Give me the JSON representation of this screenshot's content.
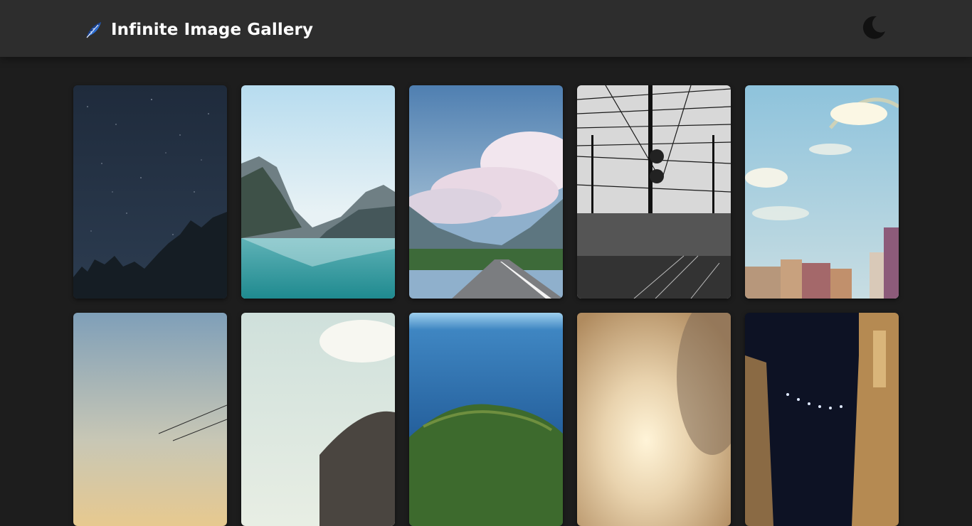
{
  "header": {
    "title": "Infinite Image Gallery",
    "logo_icon": "feather-icon",
    "theme_toggle_icon": "moon-icon"
  },
  "colors": {
    "header_bg": "#2d2d2d",
    "page_bg": "#1d1d1d",
    "text": "#ffffff",
    "logo_blue": "#2b6fd6",
    "moon": "#111111"
  },
  "gallery": {
    "images": [
      {
        "subject": "starry-night-sky-with-tree-silhouettes"
      },
      {
        "subject": "mountain-lake-reflection"
      },
      {
        "subject": "mountain-road-under-clouds"
      },
      {
        "subject": "black-and-white-railway-overhead-lines"
      },
      {
        "subject": "rainbow-over-city-skyline"
      },
      {
        "subject": "dusk-sky-with-power-lines"
      },
      {
        "subject": "pale-sky-with-hill"
      },
      {
        "subject": "deep-blue-sea-with-forested-island"
      },
      {
        "subject": "sunlight-through-blurred-foliage"
      },
      {
        "subject": "night-street-with-lanterns"
      }
    ]
  }
}
